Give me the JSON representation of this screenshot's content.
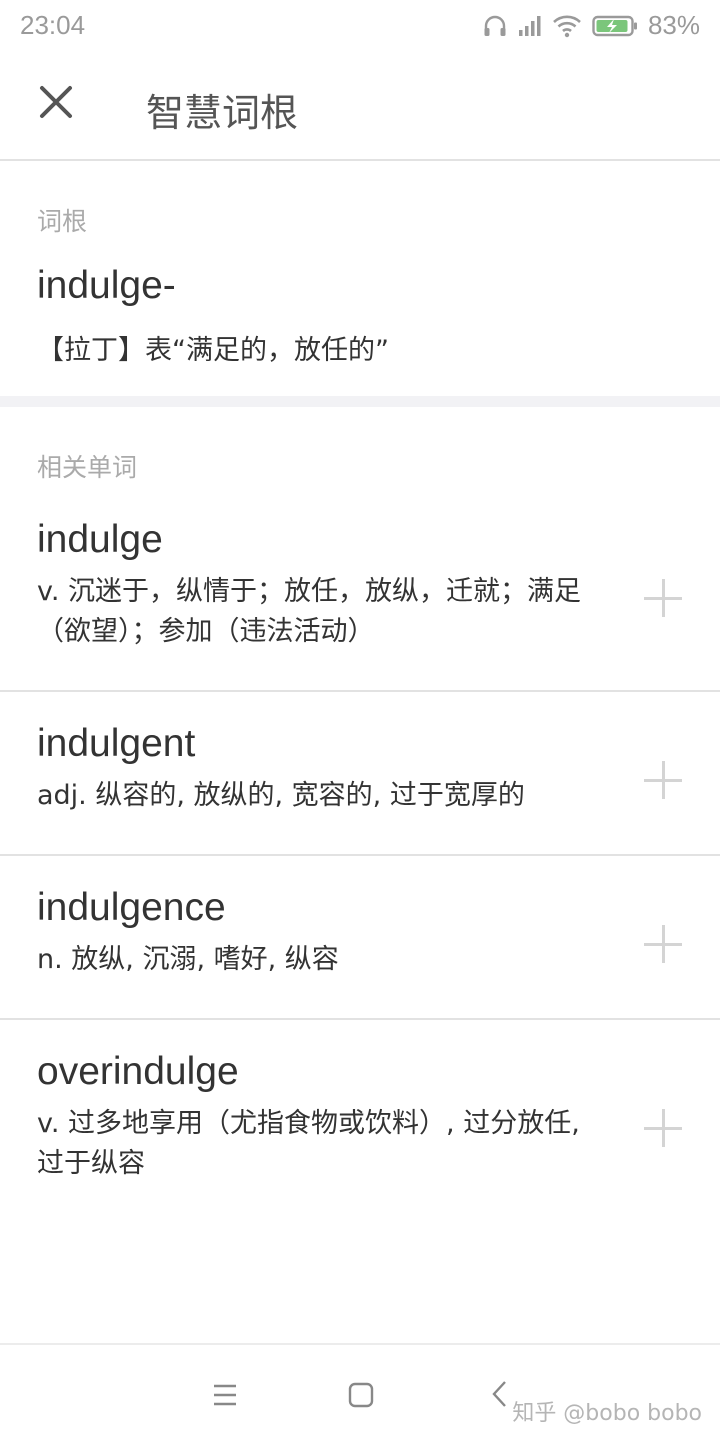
{
  "status_bar": {
    "time": "23:04",
    "battery": "83%",
    "icons": [
      "headphones-icon",
      "signal-icon",
      "wifi-icon",
      "battery-charging-icon"
    ],
    "battery_color": "#7bc67b"
  },
  "header": {
    "title": "智慧词根",
    "close_icon": "close-icon"
  },
  "root_section": {
    "label": "词根",
    "root": "indulge-",
    "meaning": "【拉丁】表“满足的，放任的”"
  },
  "related_section": {
    "label": "相关单词",
    "words": [
      {
        "word": "indulge",
        "meaning": "v. 沉迷于，纵情于；放任，放纵，迁就；满足（欲望）；参加（违法活动）"
      },
      {
        "word": "indulgent",
        "meaning": "adj. 纵容的, 放纵的, 宽容的, 过于宽厚的"
      },
      {
        "word": "indulgence",
        "meaning": "n. 放纵, 沉溺, 嗜好, 纵容"
      },
      {
        "word": "overindulge",
        "meaning": "v. 过多地享用（尤指食物或饮料）, 过分放任, 过于纵容"
      }
    ]
  },
  "nav_bar": {
    "icons": [
      "menu-icon",
      "home-icon",
      "back-icon"
    ],
    "watermark": "知乎 @bobo bobo"
  }
}
